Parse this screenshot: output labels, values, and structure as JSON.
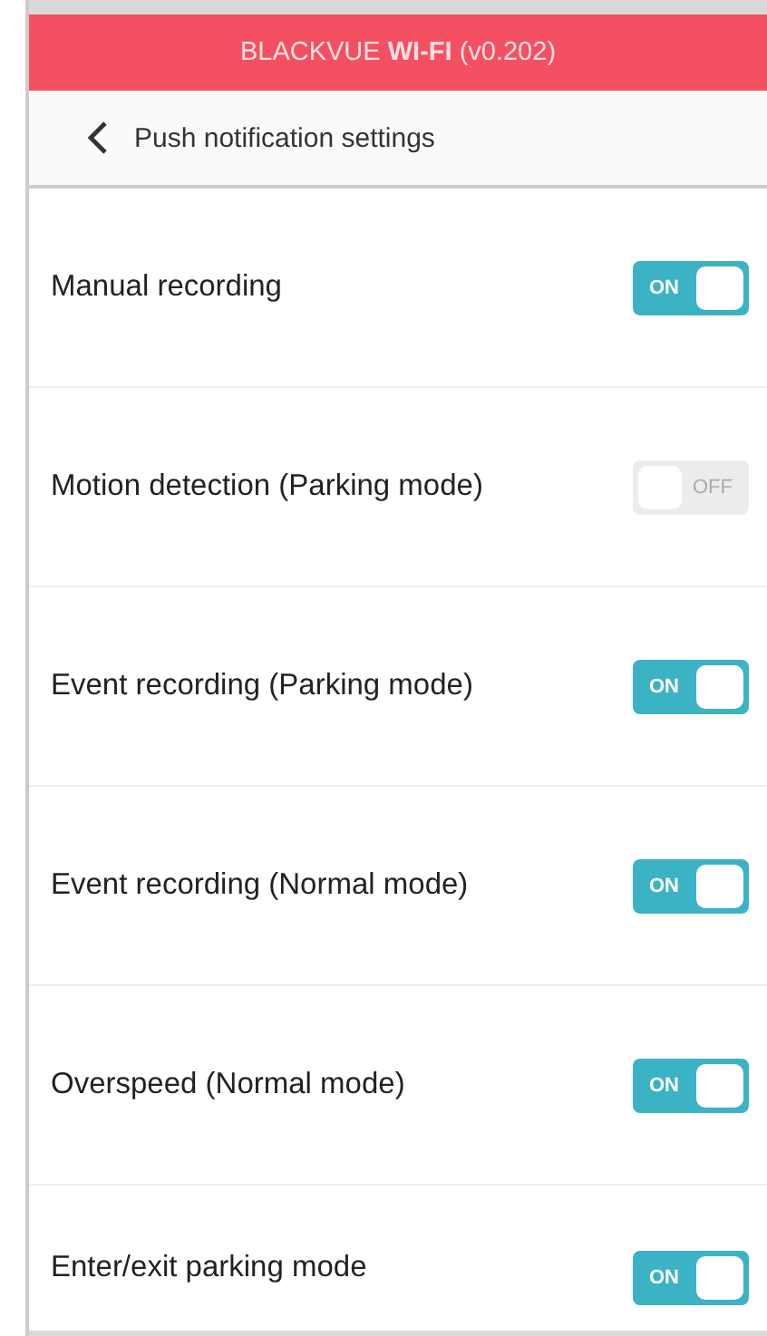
{
  "header": {
    "title": "BLACKVUE **WI-FI** (v0.202)"
  },
  "nav": {
    "title": "Push notification settings"
  },
  "settings": [
    {
      "label": "Manual recording",
      "on": true,
      "toggle_text": "ON"
    },
    {
      "label": "Motion detection (Parking mode)",
      "on": false,
      "toggle_text": "OFF"
    },
    {
      "label": "Event recording (Parking mode)",
      "on": true,
      "toggle_text": "ON"
    },
    {
      "label": "Event recording (Normal mode)",
      "on": true,
      "toggle_text": "ON"
    },
    {
      "label": "Overspeed (Normal mode)",
      "on": true,
      "toggle_text": "ON"
    },
    {
      "label": "Enter/exit parking mode",
      "on": true,
      "toggle_text": "ON"
    }
  ]
}
